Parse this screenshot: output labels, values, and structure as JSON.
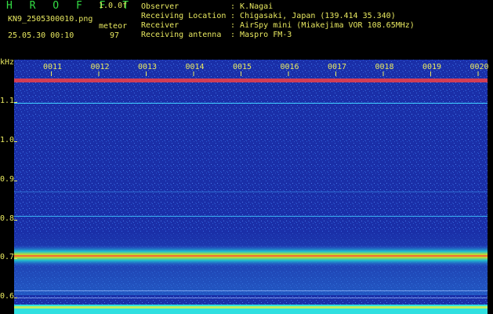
{
  "header": {
    "app_title": "H R O F F T",
    "version": "1.0.0f",
    "filename": "KN9_2505300010.png",
    "timestamp": "25.05.30 00:10",
    "mode": "meteor",
    "count": "97",
    "info": [
      {
        "key": "Observer",
        "value": "K.Nagai"
      },
      {
        "key": "Receiving Location",
        "value": "Chigasaki, Japan (139.414 35.340)"
      },
      {
        "key": "Receiver",
        "value": "AirSpy mini (Miakejima VOR 108.65MHz)"
      },
      {
        "key": "Receiving antenna",
        "value": "Maspro FM-3"
      }
    ]
  },
  "spectrogram": {
    "y_unit": "kHz",
    "y_ticks": [
      "1.1",
      "1.0",
      "0.9",
      "0.8",
      "0.7",
      "0.6"
    ],
    "x_ticks": [
      "0011",
      "0012",
      "0013",
      "0014",
      "0015",
      "0016",
      "0017",
      "0018",
      "0019",
      "0020"
    ],
    "colors": {
      "background": "#1a2fa8",
      "band": "#ff3040",
      "tick": "#e8e860"
    }
  }
}
